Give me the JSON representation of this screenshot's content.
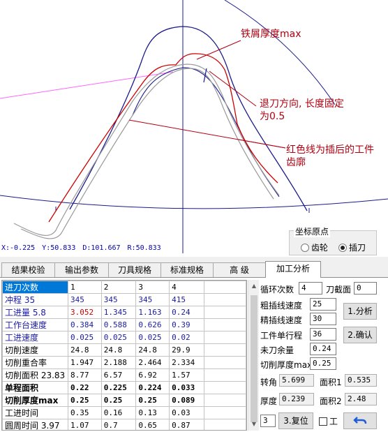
{
  "canvas": {
    "readout": {
      "x": "X:-0.225",
      "y": "Y:50.833",
      "d": "D:101.667",
      "r": "R:50.833"
    },
    "annotations": {
      "chip": "铁屑厚度max",
      "retract_line1": "退刀方向, 长度固定",
      "retract_line2": "为0.5",
      "red_line1": "红色线为插后的工件",
      "red_line2": "齿廓"
    },
    "colors": {
      "red": "#cc0000",
      "blue": "#1a1a8c",
      "gray": "#9a9a9a",
      "magenta": "#ff66ff",
      "annotation": "#b00010"
    }
  },
  "origin": {
    "title": "坐标原点",
    "options": [
      {
        "label": "齿轮",
        "selected": false
      },
      {
        "label": "插刀",
        "selected": true
      }
    ]
  },
  "tabs": [
    {
      "label": "结果校验",
      "active": false
    },
    {
      "label": "输出参数",
      "active": false
    },
    {
      "label": "刀具规格",
      "active": false
    },
    {
      "label": "标准规格",
      "active": false
    },
    {
      "label": "高 级",
      "active": false
    },
    {
      "label": "加工分析",
      "active": true
    }
  ],
  "grid": {
    "rows": [
      {
        "name": "进刀次数",
        "style": "selected",
        "cells": [
          "1",
          "2",
          "3",
          "4"
        ]
      },
      {
        "name": "冲程 35",
        "style": "blue",
        "cells": [
          "345",
          "345",
          "345",
          "415"
        ]
      },
      {
        "name": "工进量 5.8",
        "style": "blue",
        "cells": [
          "3.052",
          "1.345",
          "1.163",
          "0.24"
        ],
        "first_cell_red": true
      },
      {
        "name": "工作台速度",
        "style": "blue",
        "cells": [
          "0.384",
          "0.588",
          "0.626",
          "0.39"
        ]
      },
      {
        "name": "工进速度",
        "style": "blue",
        "cells": [
          "0.025",
          "0.025",
          "0.025",
          "0.02"
        ]
      },
      {
        "name": "切削速度",
        "style": "normal",
        "cells": [
          "24.8",
          "24.8",
          "24.8",
          "29.9"
        ]
      },
      {
        "name": "切削重合率",
        "style": "normal",
        "cells": [
          "1.947",
          "2.188",
          "2.464",
          "2.334"
        ]
      },
      {
        "name": "切削面积 23.83",
        "style": "normal",
        "cells": [
          "8.77",
          "6.57",
          "6.92",
          "1.57"
        ]
      },
      {
        "name": "单程面积",
        "style": "bold",
        "cells": [
          "0.22",
          "0.225",
          "0.224",
          "0.033"
        ]
      },
      {
        "name": "切削厚度max",
        "style": "bold",
        "cells": [
          "0.25",
          "0.25",
          "0.25",
          "0.089"
        ]
      },
      {
        "name": "工进时间",
        "style": "normal",
        "cells": [
          "0.35",
          "0.16",
          "0.13",
          "0.03"
        ]
      },
      {
        "name": "圆周时间 3.97",
        "style": "normal",
        "cells": [
          "1.07",
          "0.7",
          "0.65",
          "0.87"
        ]
      }
    ]
  },
  "panel": {
    "cycle_label": "循环次数",
    "cycle_value": "4",
    "section_label": "刀截面",
    "section_value": "0",
    "rough_label": "粗插线速度",
    "rough_value": "25",
    "fine_label": "精插线速度",
    "fine_value": "30",
    "travel_label": "工件单行程",
    "travel_value": "36",
    "remain_label": "未刀余量",
    "remain_value": "0.24",
    "thickness_label": "切削厚度max",
    "thickness_value": "0.25",
    "analyze_button": "1.分析",
    "confirm_button": "2.确认",
    "angle_label": "转角",
    "angle_value": "5.699",
    "area1_label": "面积1",
    "area1_value": "0.535",
    "thick_label": "厚度",
    "thick_value": "0.239",
    "area2_label": "面积2",
    "area2_value": "2.48",
    "reset_value": "3",
    "reset_button": "3.复位",
    "gong_label": "工",
    "undo_icon": "undo-arrow-icon"
  }
}
